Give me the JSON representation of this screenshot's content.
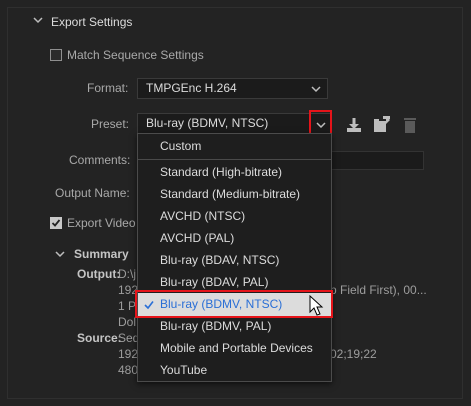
{
  "section": {
    "title": "Export Settings"
  },
  "match_sequence": {
    "label": "Match Sequence Settings",
    "checked": false
  },
  "format": {
    "label": "Format:",
    "value": "TMPGEnc H.264"
  },
  "preset": {
    "label": "Preset:",
    "value": "Blu-ray (BDMV, NTSC)"
  },
  "comments": {
    "label": "Comments:"
  },
  "output_name": {
    "label": "Output Name:"
  },
  "export_video": {
    "label": "Export Video",
    "checked": true
  },
  "summary": {
    "title": "Summary",
    "output_label": "Output:",
    "output_lines": [
      "D:\\j",
      "192",
      "1 P",
      "Dol"
    ],
    "output_tail": "p Field First), 00...",
    "source_label": "Source:",
    "source_lines": [
      "Seq",
      "192",
      "480"
    ],
    "source_tail": "02;19;22"
  },
  "dropdown": {
    "items": [
      "Custom",
      "Standard (High-bitrate)",
      "Standard (Medium-bitrate)",
      "AVCHD (NTSC)",
      "AVCHD (PAL)",
      "Blu-ray (BDAV, NTSC)",
      "Blu-ray (BDAV, PAL)",
      "Blu-ray (BDMV, NTSC)",
      "Blu-ray (BDMV, PAL)",
      "Mobile and Portable Devices",
      "YouTube"
    ],
    "selected_index": 7
  },
  "colors": {
    "highlight": "#e5141a",
    "selected_text": "#2a6fd6"
  }
}
